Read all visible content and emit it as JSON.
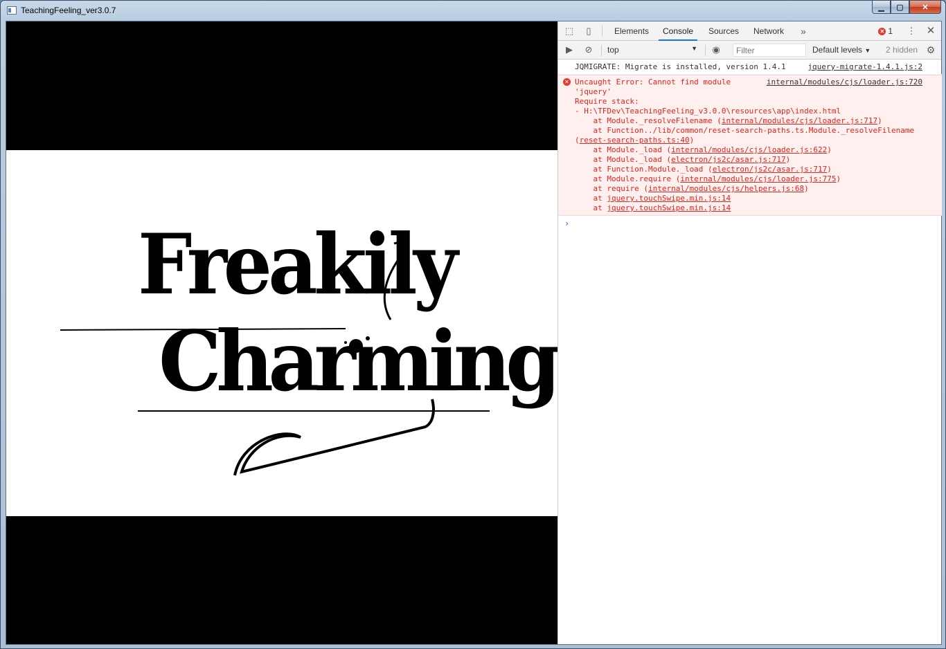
{
  "window": {
    "title": "TeachingFeeling_ver3.0.7"
  },
  "logo": {
    "line1": "Freakily",
    "line2": "Charming"
  },
  "devtools": {
    "tabs": [
      "Elements",
      "Console",
      "Sources",
      "Network"
    ],
    "active_tab": "Console",
    "error_count": "1",
    "context": "top",
    "filter_placeholder": "Filter",
    "levels": "Default levels",
    "hidden": "2 hidden"
  },
  "console": {
    "info": {
      "text": "JQMIGRATE: Migrate is installed, version 1.4.1",
      "source": "jquery-migrate-1.4.1.js:2"
    },
    "error": {
      "source": "internal/modules/cjs/loader.js:720",
      "lines": [
        {
          "pre": "Uncaught Error: Cannot find module",
          "link": "",
          "post": ""
        },
        {
          "pre": "'jquery'",
          "link": "",
          "post": ""
        },
        {
          "pre": "Require stack:",
          "link": "",
          "post": ""
        },
        {
          "pre": "- H:\\TFDev\\TeachingFeeling_v3.0.0\\resources\\app\\index.html",
          "link": "",
          "post": ""
        },
        {
          "pre": "    at Module._resolveFilename (",
          "link": "internal/modules/cjs/loader.js:717",
          "post": ")"
        },
        {
          "pre": "    at Function../lib/common/reset-search-paths.ts.Module._resolveFilename",
          "link": "",
          "post": ""
        },
        {
          "pre": "(",
          "link": "reset-search-paths.ts:40",
          "post": ")"
        },
        {
          "pre": "    at Module._load (",
          "link": "internal/modules/cjs/loader.js:622",
          "post": ")"
        },
        {
          "pre": "    at Module._load (",
          "link": "electron/js2c/asar.js:717",
          "post": ")"
        },
        {
          "pre": "    at Function.Module._load (",
          "link": "electron/js2c/asar.js:717",
          "post": ")"
        },
        {
          "pre": "    at Module.require (",
          "link": "internal/modules/cjs/loader.js:775",
          "post": ")"
        },
        {
          "pre": "    at require (",
          "link": "internal/modules/cjs/helpers.js:68",
          "post": ")"
        },
        {
          "pre": "    at ",
          "link": "jquery.touchSwipe.min.js:14",
          "post": ""
        },
        {
          "pre": "    at ",
          "link": "jquery.touchSwipe.min.js:14",
          "post": ""
        }
      ]
    },
    "prompt": "›"
  }
}
